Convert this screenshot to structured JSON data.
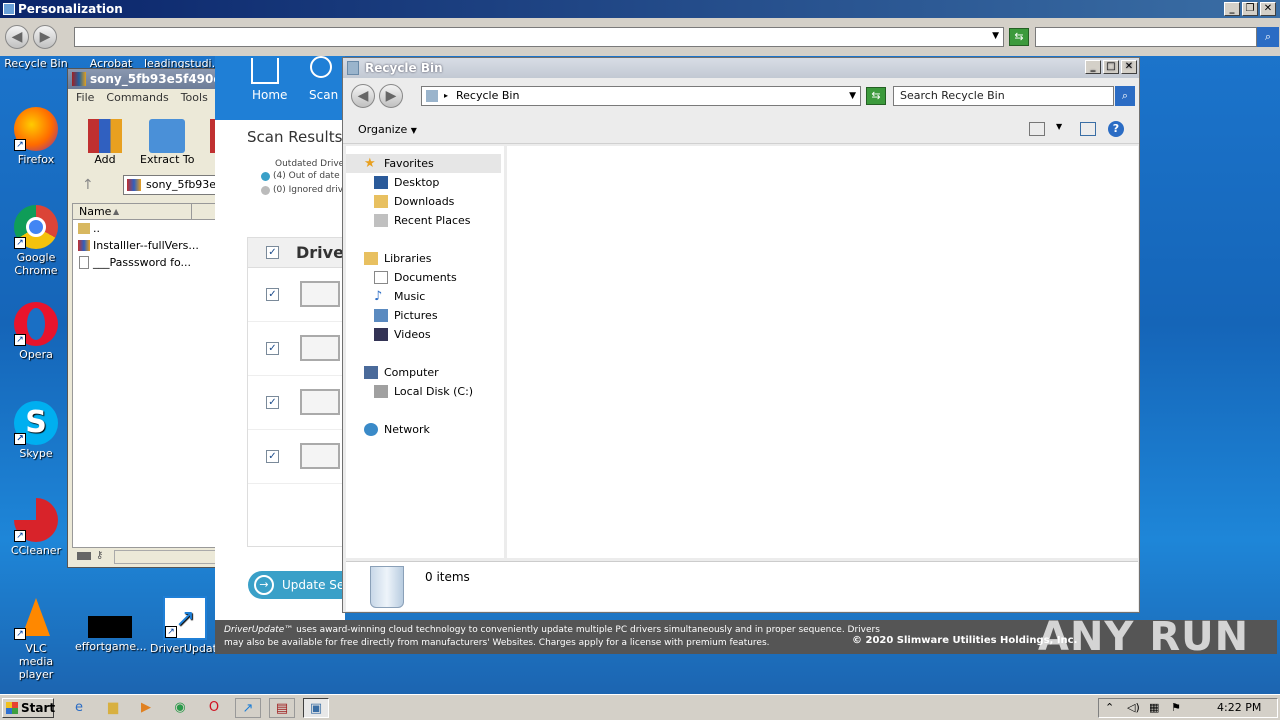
{
  "personalization": {
    "title": "Personalization"
  },
  "desktop_icons": {
    "recycle_bin": "Recycle Bin",
    "acrobat": "Acrobat",
    "leading": "leadingstudi...",
    "firefox": "Firefox",
    "chrome": "Google Chrome",
    "opera": "Opera",
    "skype": "Skype",
    "ccleaner": "CCleaner",
    "vlc": "VLC media player",
    "effort": "effortgame...",
    "driverupdate": "DriverUpdate"
  },
  "winrar": {
    "title": "sony_5fb93e5f490e6",
    "menu": [
      "File",
      "Commands",
      "Tools",
      "Fa"
    ],
    "add": "Add",
    "extract": "Extract To",
    "path": "sony_5fb93e5",
    "col_name": "Name",
    "files": [
      "..",
      "Installler--fullVers...",
      "___Passsword fo..."
    ]
  },
  "driverupdate": {
    "home": "Home",
    "scan": "Scan",
    "scan_results": "Scan Results",
    "outdated": "Outdated Drive",
    "out_of_date": "(4) Out of date d",
    "ignored": "(0) Ignored drive",
    "drivers_header": "Driver",
    "update_btn": "Update Sel",
    "footer_brand": "DriverUpdate™",
    "footer_text": "uses award-winning cloud technology to conveniently update multiple PC drivers simultaneously and in proper sequence. Drivers",
    "footer_text2": "may also be available for free directly from manufacturers' Websites. Charges apply for a license with premium features.",
    "copyright": "© 2020 Slimware Utilities Holdings, Inc."
  },
  "recycle": {
    "title": "Recycle Bin",
    "address": "Recycle Bin",
    "search_placeholder": "Search Recycle Bin",
    "organize": "Organize",
    "nav": {
      "favorites": "Favorites",
      "desktop": "Desktop",
      "downloads": "Downloads",
      "recent": "Recent Places",
      "libraries": "Libraries",
      "documents": "Documents",
      "music": "Music",
      "pictures": "Pictures",
      "videos": "Videos",
      "computer": "Computer",
      "localdisk": "Local Disk (C:)",
      "network": "Network"
    },
    "status": "0 items"
  },
  "taskbar": {
    "start": "Start",
    "clock": "4:22 PM"
  },
  "watermark": "ANY RUN"
}
